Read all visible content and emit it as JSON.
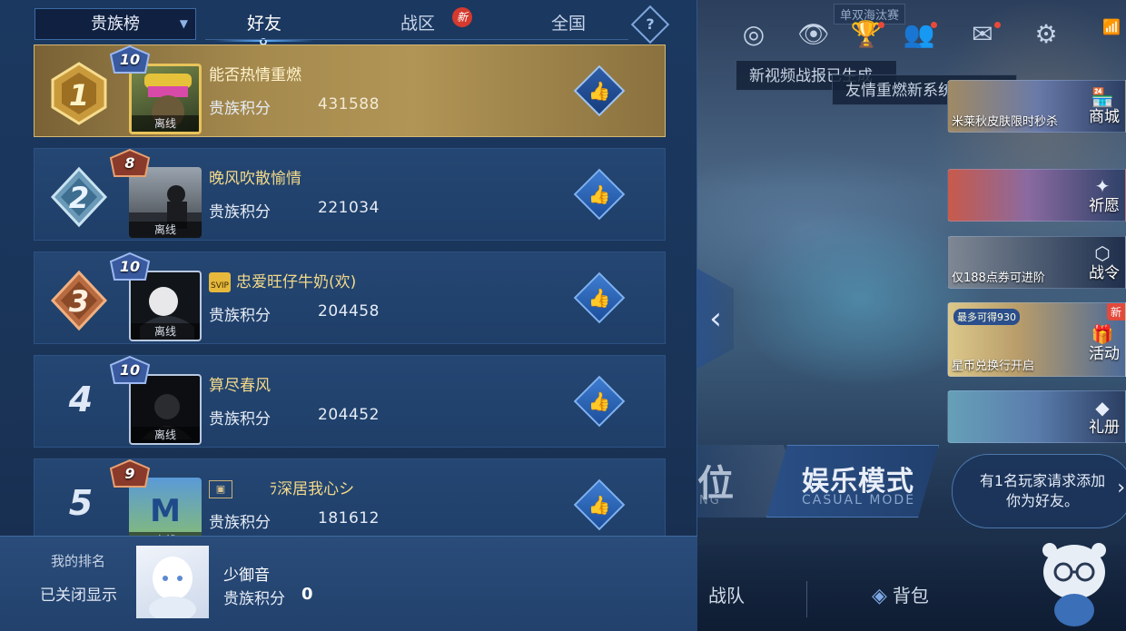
{
  "panel": {
    "dropdown_label": "贵族榜",
    "tabs": [
      {
        "label": "好友"
      },
      {
        "label": "战区",
        "badge": "新"
      },
      {
        "label": "全国"
      }
    ],
    "help_symbol": "?",
    "offline_label": "离线",
    "score_label": "贵族积分",
    "rows": [
      {
        "rank": "1",
        "level": "10",
        "name": "能否热情重燃",
        "score": "431588"
      },
      {
        "rank": "2",
        "level": "8",
        "name": "晚风吹散愉情",
        "score": "221034"
      },
      {
        "rank": "3",
        "level": "10",
        "name": "忠爱旺仔牛奶(欢)",
        "score": "204458",
        "vip_text": "SVIP"
      },
      {
        "rank": "4",
        "level": "10",
        "name": "算尽春风",
        "score": "204452"
      },
      {
        "rank": "5",
        "level": "9",
        "name": "ﾠﾠ ﾗ深居我心シ",
        "score": "181612"
      }
    ],
    "my_rank": {
      "label": "我的排名",
      "status": "已关闭显示",
      "name": "少御音",
      "score_label": "贵族积分",
      "score": "0"
    }
  },
  "scene": {
    "overlay_tag": "单双海汰赛",
    "toast1": "新视频战报已生成",
    "toast2": "友情重燃新系统上线",
    "side_cards": [
      {
        "caption": "米莱秋皮肤限时秒杀",
        "label": "商城"
      },
      {
        "caption": "",
        "label": "祈愿"
      },
      {
        "caption": "仅188点券可进阶",
        "label": "战令"
      },
      {
        "caption": "星币兑换行开启",
        "label": "活动",
        "badge": "新",
        "mini": "最多可得930"
      },
      {
        "caption": "",
        "label": "礼册"
      }
    ],
    "mode_left_big": "位",
    "mode_left_small": "NG",
    "mode_big": "娱乐模式",
    "mode_small": "CASUAL MODE",
    "friend_request": "有1名玩家请求添加你为好友。",
    "bottom": {
      "team": "战队",
      "bag": "背包"
    }
  },
  "colors": {
    "panel_bg": "#1b3860",
    "gold_row": "#a58a4e",
    "name_gold": "#f3d98a",
    "accent_blue": "#5fb0ff",
    "badge_red": "#d43a2e"
  },
  "icons": [
    "dropdown-caret-icon",
    "help-icon",
    "thumbs-up-icon",
    "rank-medal-icon",
    "level-badge-icon",
    "vip-icon",
    "target-icon",
    "eye-icon",
    "trophy-icon",
    "friends-icon",
    "mail-icon",
    "gear-icon",
    "signal-icon",
    "collapse-chevron-icon",
    "bag-icon"
  ]
}
